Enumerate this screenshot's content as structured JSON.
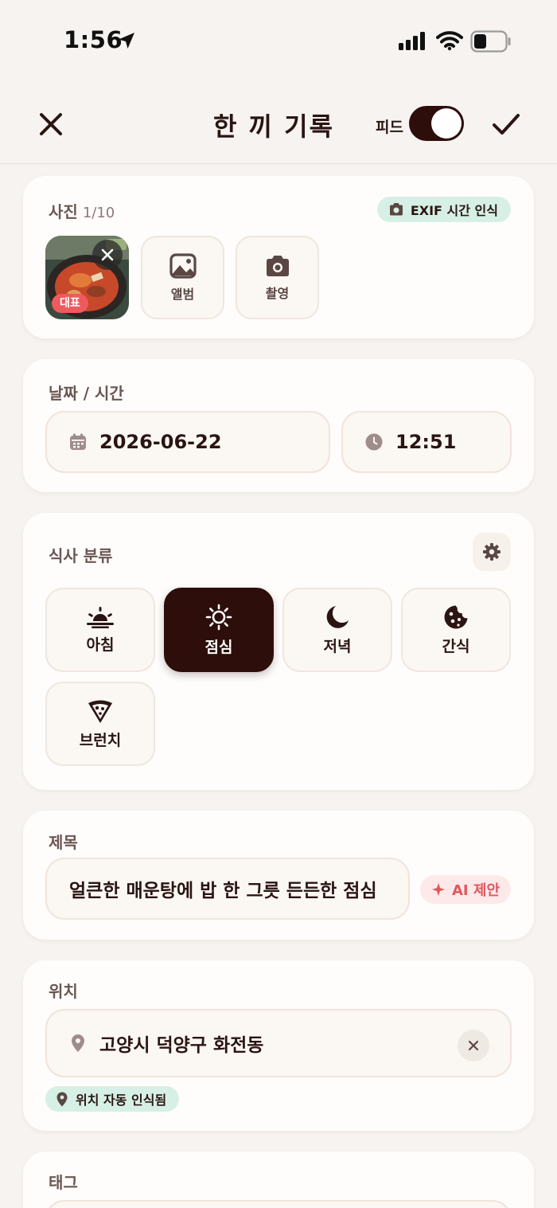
{
  "status_bar": {
    "time": "1:56"
  },
  "header": {
    "title": "한 끼 기록",
    "feed_label": "피드",
    "feed_enabled": true
  },
  "photos": {
    "label": "사진",
    "count": "1/10",
    "exif_badge": "EXIF 시간 인식",
    "thumbnail_badge": "대표",
    "album_label": "앨범",
    "camera_label": "촬영"
  },
  "datetime": {
    "label": "날짜 / 시간",
    "date": "2026-06-22",
    "time": "12:51"
  },
  "meal_type": {
    "label": "식사 분류",
    "options": [
      {
        "label": "아침",
        "icon": "sunrise-icon"
      },
      {
        "label": "점심",
        "icon": "sun-icon"
      },
      {
        "label": "저녁",
        "icon": "moon-icon"
      },
      {
        "label": "간식",
        "icon": "cookie-icon"
      },
      {
        "label": "브런치",
        "icon": "pizza-slice-icon"
      }
    ],
    "selected": "점심"
  },
  "title_field": {
    "label": "제목",
    "value": "얼큰한 매운탕에 밥 한 그릇 든든한 점심",
    "ai_badge": "AI 제안"
  },
  "location": {
    "label": "위치",
    "value": "고양시 덕양구 화전동",
    "auto_badge": "위치 자동 인식됨"
  },
  "tags": {
    "label": "태그"
  },
  "colors": {
    "primary_dark": "#2d0e0a",
    "background": "#f6f3f0",
    "card": "#fefdfc",
    "mint_badge": "#d7f0e6",
    "ai_pink": "#fde9ea",
    "ai_text": "#e0585c",
    "rep_badge": "#ef5a5f"
  }
}
